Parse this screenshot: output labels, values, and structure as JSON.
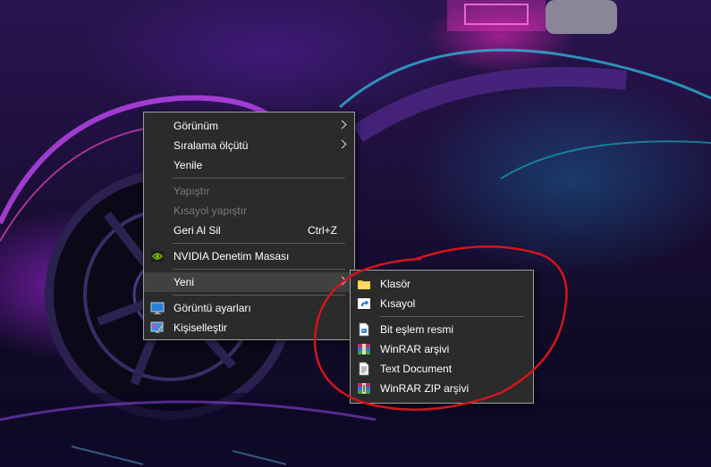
{
  "accent_annotation_color": "#d4141c",
  "context_menu": {
    "items": [
      {
        "label": "Görünüm",
        "submenu": true
      },
      {
        "label": "Sıralama ölçütü",
        "submenu": true
      },
      {
        "label": "Yenile"
      },
      {
        "label": "Yapıştır",
        "disabled": true
      },
      {
        "label": "Kısayol yapıştır",
        "disabled": true
      },
      {
        "label": "Geri Al Sil",
        "shortcut": "Ctrl+Z"
      },
      {
        "label": "NVIDIA Denetim Masası",
        "icon": "nvidia-icon"
      },
      {
        "label": "Yeni",
        "submenu": true,
        "highlighted": true
      },
      {
        "label": "Görüntü ayarları",
        "icon": "display-settings-icon"
      },
      {
        "label": "Kişiselleştir",
        "icon": "personalize-icon"
      }
    ]
  },
  "new_submenu": {
    "items": [
      {
        "label": "Klasör",
        "icon": "folder-icon"
      },
      {
        "label": "Kısayol",
        "icon": "shortcut-icon"
      },
      {
        "label": "Bit eşlem resmi",
        "icon": "bitmap-image-icon"
      },
      {
        "label": "WinRAR arşivi",
        "icon": "winrar-archive-icon"
      },
      {
        "label": "Text Document",
        "icon": "text-document-icon"
      },
      {
        "label": "WinRAR ZIP arşivi",
        "icon": "winrar-zip-icon"
      }
    ]
  }
}
